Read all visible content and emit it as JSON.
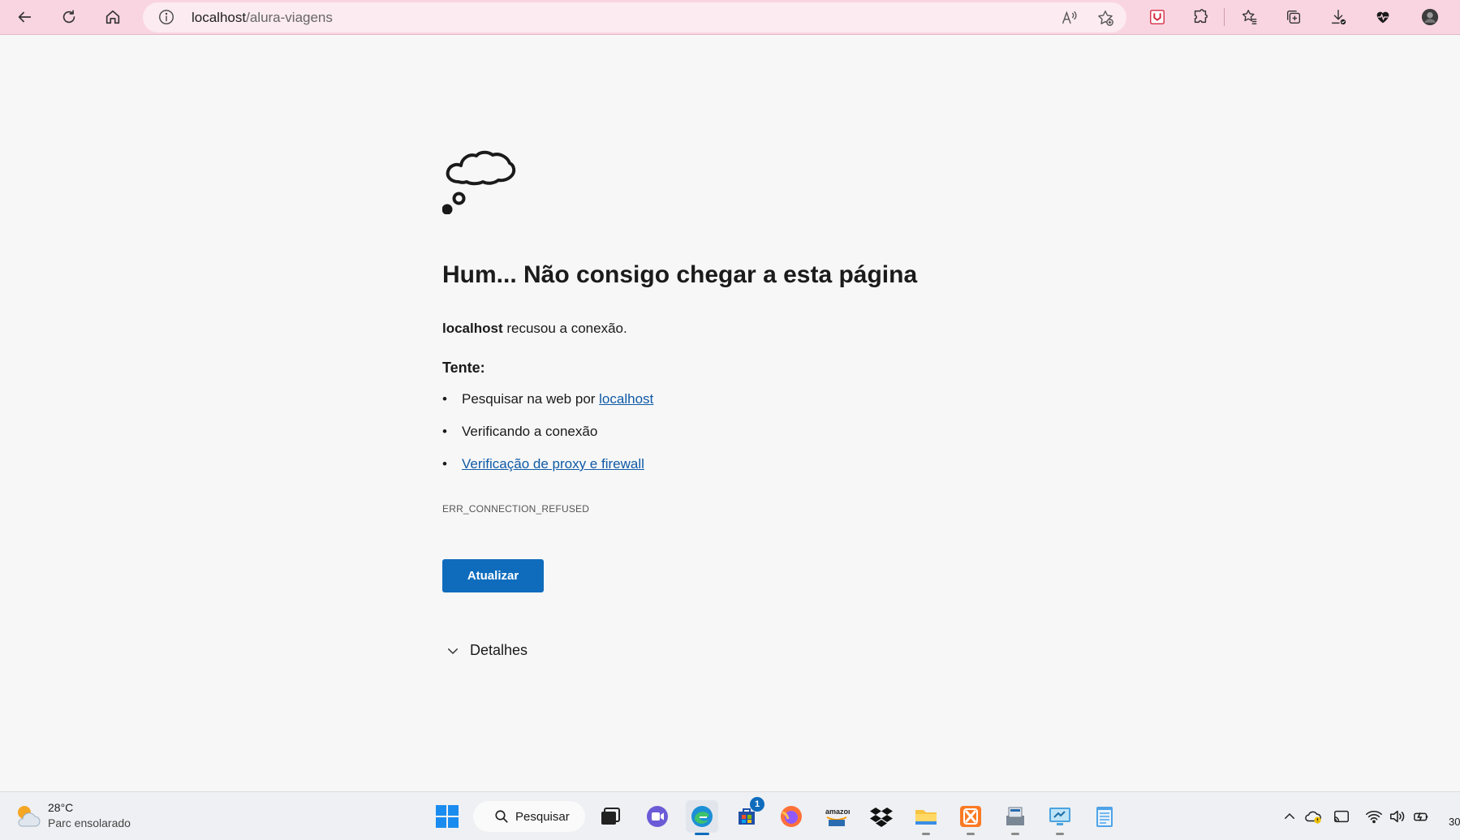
{
  "browser": {
    "url_host": "localhost",
    "url_path": "/alura-viagens",
    "colors": {
      "toolbar_bg": "#f9d5e1",
      "address_bg": "#fcebf1"
    },
    "icons": [
      "back-icon",
      "refresh-icon",
      "home-icon",
      "info-icon",
      "read-aloud-icon",
      "add-favorite-icon",
      "extension-shield-icon",
      "extensions-puzzle-icon",
      "favorites-star-icon",
      "collections-icon",
      "downloads-icon",
      "browser-essentials-heart-icon",
      "profile-avatar"
    ]
  },
  "error_page": {
    "title": "Hum... Não consigo chegar a esta página",
    "host": "localhost",
    "message_rest": " recusou a conexão.",
    "try_label": "Tente:",
    "suggestions": {
      "search_prefix": "Pesquisar na web por ",
      "search_link": "localhost",
      "checking": "Verificando a conexão",
      "proxy_link": "Verificação de proxy e firewall"
    },
    "error_code": "ERR_CONNECTION_REFUSED",
    "refresh_button": "Atualizar",
    "details_label": "Detalhes",
    "colors": {
      "link": "#0f5aa6",
      "button": "#0f6cbd"
    }
  },
  "taskbar": {
    "weather": {
      "temperature": "28°C",
      "condition": "Parc ensolarado"
    },
    "search_label": "Pesquisar",
    "store_badge": "1",
    "clock_partial": "30",
    "apps": [
      "start-icon",
      "task-view-icon",
      "chat-icon",
      "edge-icon",
      "store-icon",
      "firefox-icon",
      "amazon-icon",
      "dropbox-icon",
      "file-explorer-icon",
      "xampp-icon",
      "app-icon",
      "remote-desktop-icon",
      "notepad-icon"
    ]
  }
}
